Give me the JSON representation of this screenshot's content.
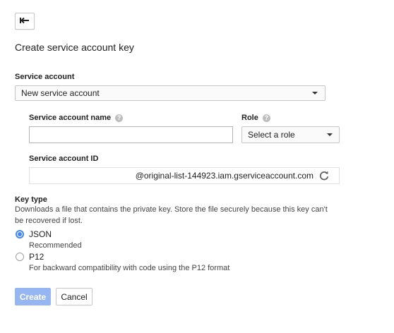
{
  "page": {
    "title": "Create service account key"
  },
  "service_account": {
    "label": "Service account",
    "selected": "New service account"
  },
  "name_field": {
    "label": "Service account name",
    "value": "",
    "placeholder": ""
  },
  "role": {
    "label": "Role",
    "selected": "Select a role"
  },
  "id_field": {
    "label": "Service account ID",
    "value": "",
    "suffix": "@original-list-144923.iam.gserviceaccount.com"
  },
  "key_type": {
    "label": "Key type",
    "description": "Downloads a file that contains the private key. Store the file securely because this key can't be recovered if lost.",
    "options": [
      {
        "label": "JSON",
        "sublabel": "Recommended",
        "checked": true
      },
      {
        "label": "P12",
        "sublabel": "For backward compatibility with code using the P12 format",
        "checked": false
      }
    ]
  },
  "actions": {
    "create": "Create",
    "cancel": "Cancel"
  },
  "colors": {
    "accent": "#4285f4",
    "create_disabled": "#96b6f3"
  }
}
